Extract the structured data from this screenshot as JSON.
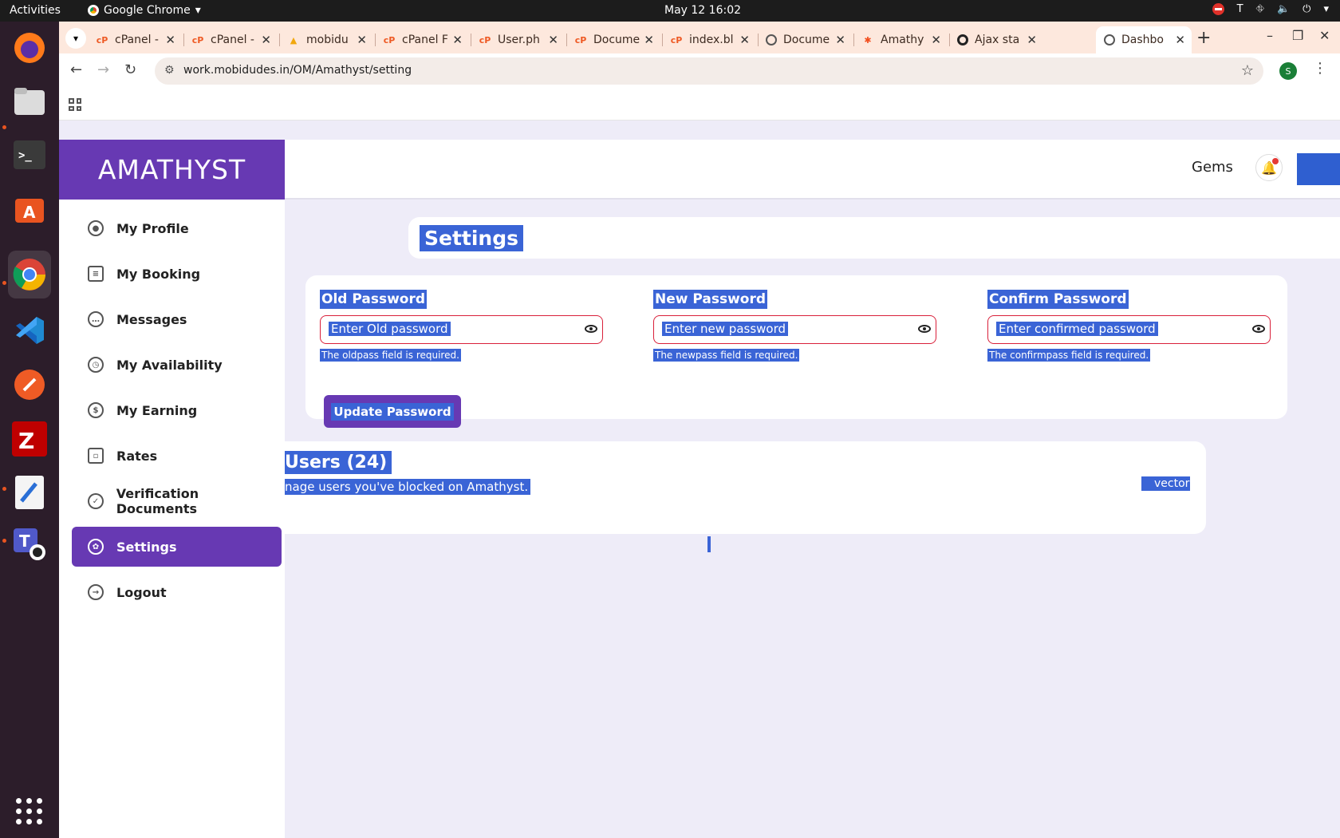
{
  "system": {
    "activities": "Activities",
    "app_name": "Google Chrome",
    "clock": "May 12  16:02"
  },
  "dock": {
    "items": [
      "firefox-icon",
      "files-icon",
      "terminal-icon",
      "app-center-icon",
      "chrome-icon",
      "vscode-icon",
      "postman-icon",
      "filezilla-icon",
      "text-editor-icon",
      "teams-for-linux-icon"
    ],
    "show_apps": "show-apps-icon"
  },
  "browser": {
    "tabs": [
      {
        "title": "cPanel -",
        "icon": "cpanel-icon"
      },
      {
        "title": "cPanel -",
        "icon": "cpanel-icon"
      },
      {
        "title": "mobidu",
        "icon": "phpmyadmin-icon"
      },
      {
        "title": "cPanel F",
        "icon": "cpanel-icon"
      },
      {
        "title": "User.ph",
        "icon": "cpanel-icon"
      },
      {
        "title": "Docume",
        "icon": "cpanel-icon"
      },
      {
        "title": "index.bl",
        "icon": "cpanel-icon"
      },
      {
        "title": "Docume",
        "icon": "globe-icon"
      },
      {
        "title": "Amathy",
        "icon": "figma-icon"
      },
      {
        "title": "Ajax sta",
        "icon": "ajax-icon"
      },
      {
        "title": "Dashbo",
        "icon": "globe-icon",
        "active": true
      }
    ],
    "url": "work.mobidudes.in/OM/Amathyst/setting",
    "profile_initial": "S"
  },
  "app": {
    "brand": "AMATHYST",
    "header": {
      "gems": "Gems"
    },
    "nav": [
      {
        "label": "My Profile",
        "icon": "user-icon"
      },
      {
        "label": "My Booking",
        "icon": "document-icon"
      },
      {
        "label": "Messages",
        "icon": "chat-icon"
      },
      {
        "label": "My Availability",
        "icon": "clock-icon"
      },
      {
        "label": "My Earning",
        "icon": "dollar-icon"
      },
      {
        "label": "Rates",
        "icon": "rates-icon"
      },
      {
        "label": "Verification Documents",
        "icon": "check-circle-icon"
      },
      {
        "label": "Settings",
        "icon": "gear-icon",
        "active": true
      },
      {
        "label": "Logout",
        "icon": "logout-icon"
      }
    ],
    "settings": {
      "title": "Settings",
      "old_password": {
        "label": "Old Password",
        "placeholder": "Enter Old password",
        "error": "The oldpass field is required."
      },
      "new_password": {
        "label": "New Password",
        "placeholder": "Enter new password",
        "error": "The newpass field is required."
      },
      "confirm_password": {
        "label": "Confirm Password",
        "placeholder": "Enter confirmed password",
        "error": "The confirmpass field is required."
      },
      "update_button": "Update Password"
    },
    "blocked": {
      "title": "Users (24)",
      "subtitle": "nage users you've blocked on Amathyst.",
      "image_alt": "vector"
    }
  },
  "colors": {
    "brand": "#6739b3",
    "selection": "#3a64d6",
    "error": "#d9203a"
  }
}
